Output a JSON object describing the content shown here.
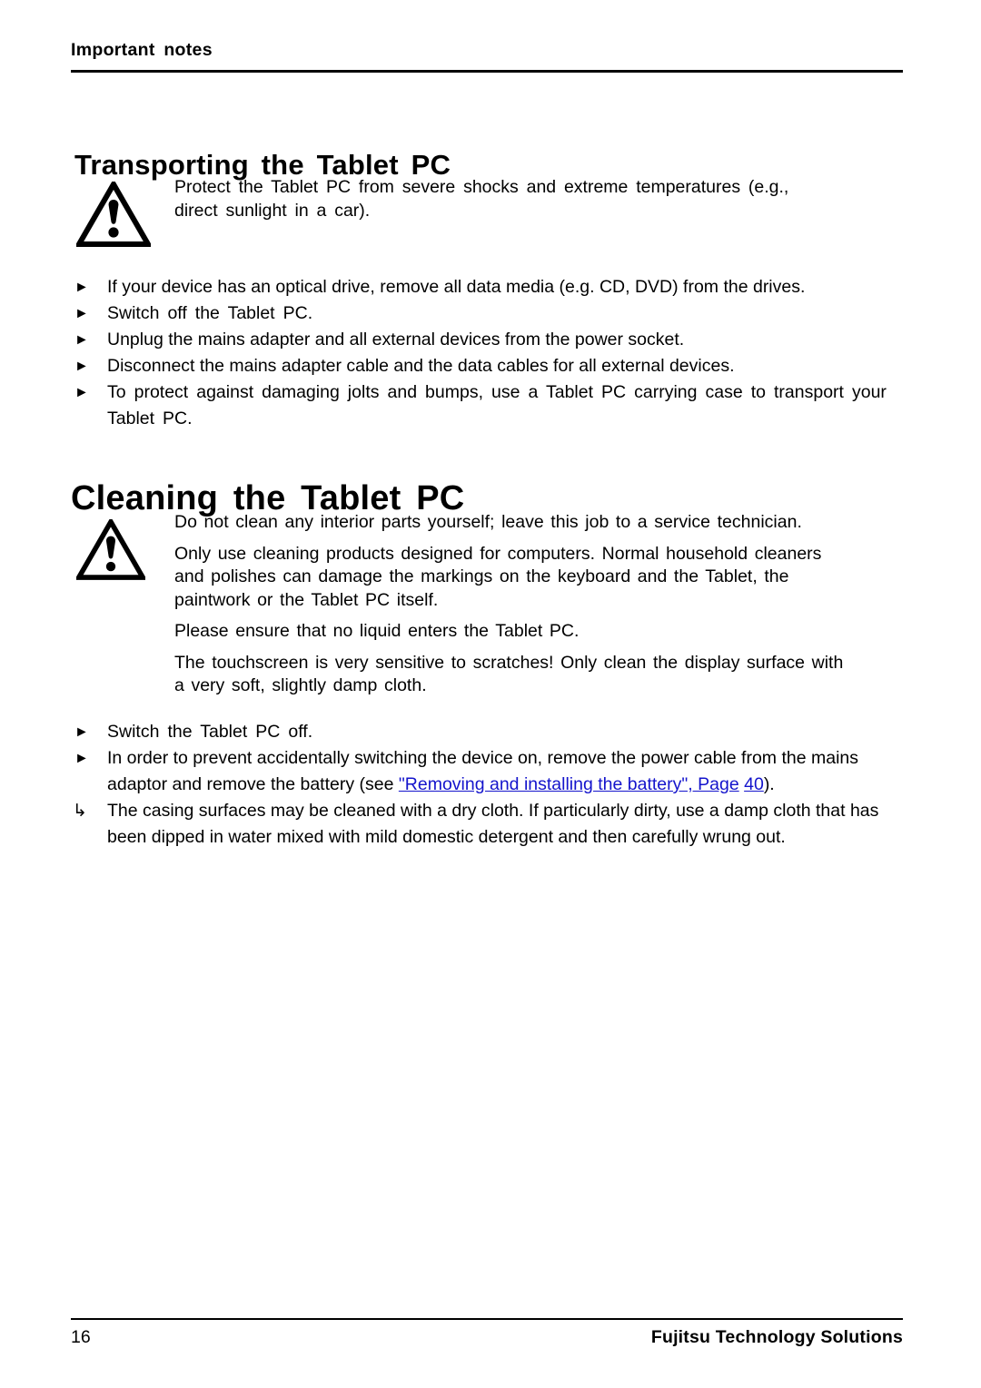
{
  "document": {
    "running_header": "Important  notes",
    "page_number": "16",
    "company": "Fujitsu Technology Solutions"
  },
  "sections": [
    {
      "id": "transporting",
      "heading": "Transporting  the  Tablet  PC",
      "note": {
        "icon": "warning-triangle-icon",
        "paragraphs": [
          "Protect the Tablet PC from severe shocks and extreme temperatures (e.g., direct sunlight in a car)."
        ]
      },
      "steps": [
        {
          "marker": "►",
          "text": "If your device has an optical drive, remove all data media (e.g. CD, DVD) from the drives."
        },
        {
          "marker": "►",
          "text": "Switch off the Tablet PC."
        },
        {
          "marker": "►",
          "text": "Unplug the mains adapter and all external devices from the power socket."
        },
        {
          "marker": "►",
          "text": "Disconnect the mains adapter cable and the data cables for all external devices."
        },
        {
          "marker": "►",
          "text": "To protect against damaging jolts and bumps, use a Tablet PC carrying case to transport your Tablet PC."
        }
      ]
    },
    {
      "id": "cleaning",
      "heading": "Cleaning  the  Tablet  PC",
      "note": {
        "icon": "warning-triangle-icon",
        "paragraphs": [
          "Do not clean any interior parts yourself; leave this job to a service technician.",
          "Only use cleaning products designed for computers. Normal household cleaners and polishes can damage the markings on the keyboard and the Tablet, the paintwork or the Tablet PC itself.",
          "Please ensure that no liquid enters the Tablet PC.",
          "The touchscreen is very sensitive to scratches! Only clean the display surface with a very soft, slightly damp cloth."
        ]
      },
      "steps": [
        {
          "marker": "►",
          "text": "Switch the Tablet PC off."
        },
        {
          "marker": "►",
          "text_before": "In order to prevent accidentally switching the device on, remove the power cable from the mains adaptor and remove the battery (see ",
          "link_text": "\"Removing and installing the battery\", Page",
          "link_page": "40",
          "text_after": ")."
        },
        {
          "marker": "↳",
          "text": "The casing surfaces may be cleaned with a dry cloth. If particularly dirty, use a damp cloth that has been dipped in water mixed with mild domestic detergent and then carefully wrung out."
        }
      ]
    }
  ],
  "colors": {
    "link": "#1414cc",
    "text": "#000000",
    "background": "#ffffff"
  }
}
